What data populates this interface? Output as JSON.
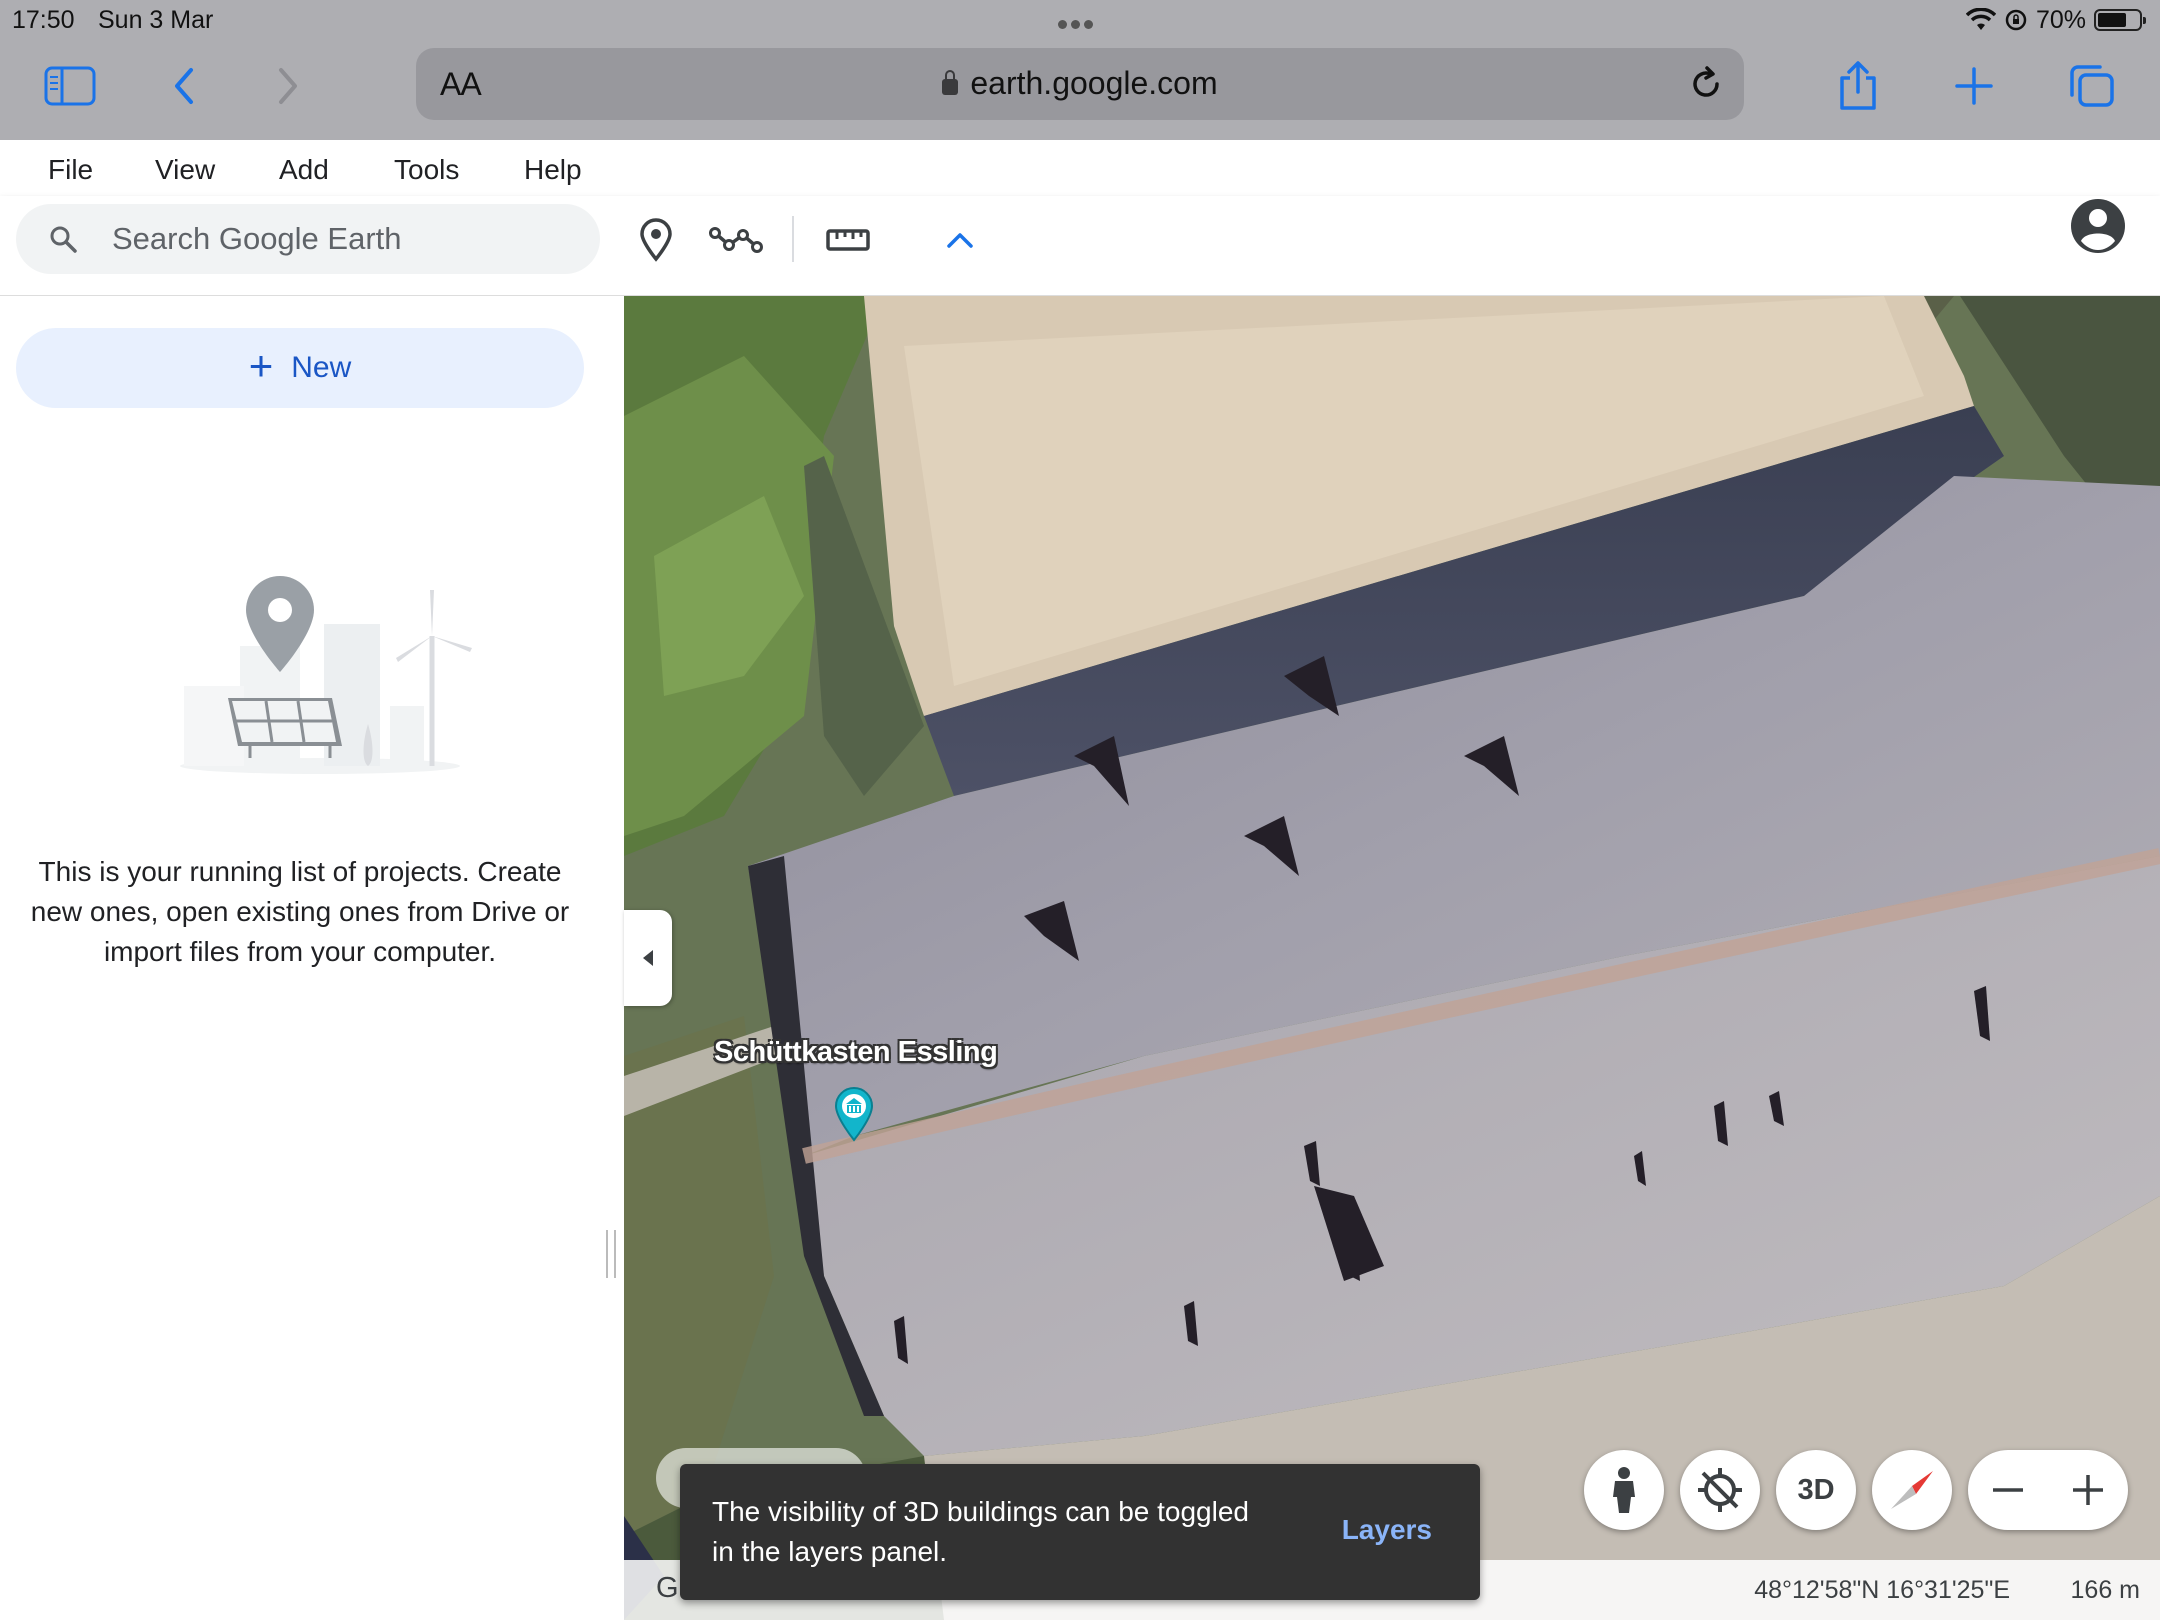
{
  "status": {
    "time": "17:50",
    "date": "Sun 3 Mar",
    "battery": "70%"
  },
  "browser": {
    "text_size": "AA",
    "url": "earth.google.com"
  },
  "menu": [
    "File",
    "View",
    "Add",
    "Tools",
    "Help"
  ],
  "search": {
    "placeholder": "Search Google Earth"
  },
  "projects": {
    "new_label": "New",
    "empty_text": "This is your running list of projects. Create new ones, open existing ones from Drive or import files from your computer."
  },
  "map": {
    "place_label": "Schüttkasten Essling",
    "control_3d": "3D",
    "coordinates": "48°12'58\"N 16°31'25\"E",
    "altitude": "166 m",
    "logo_fragment": "G"
  },
  "snackbar": {
    "message": "The visibility of 3D buildings can be toggled in the layers panel.",
    "action": "Layers"
  },
  "colors": {
    "accent": "#1a73e8",
    "new_button_bg": "#e8f0fe",
    "snackbar_bg": "#323232",
    "snackbar_action": "#8ab4f8"
  }
}
